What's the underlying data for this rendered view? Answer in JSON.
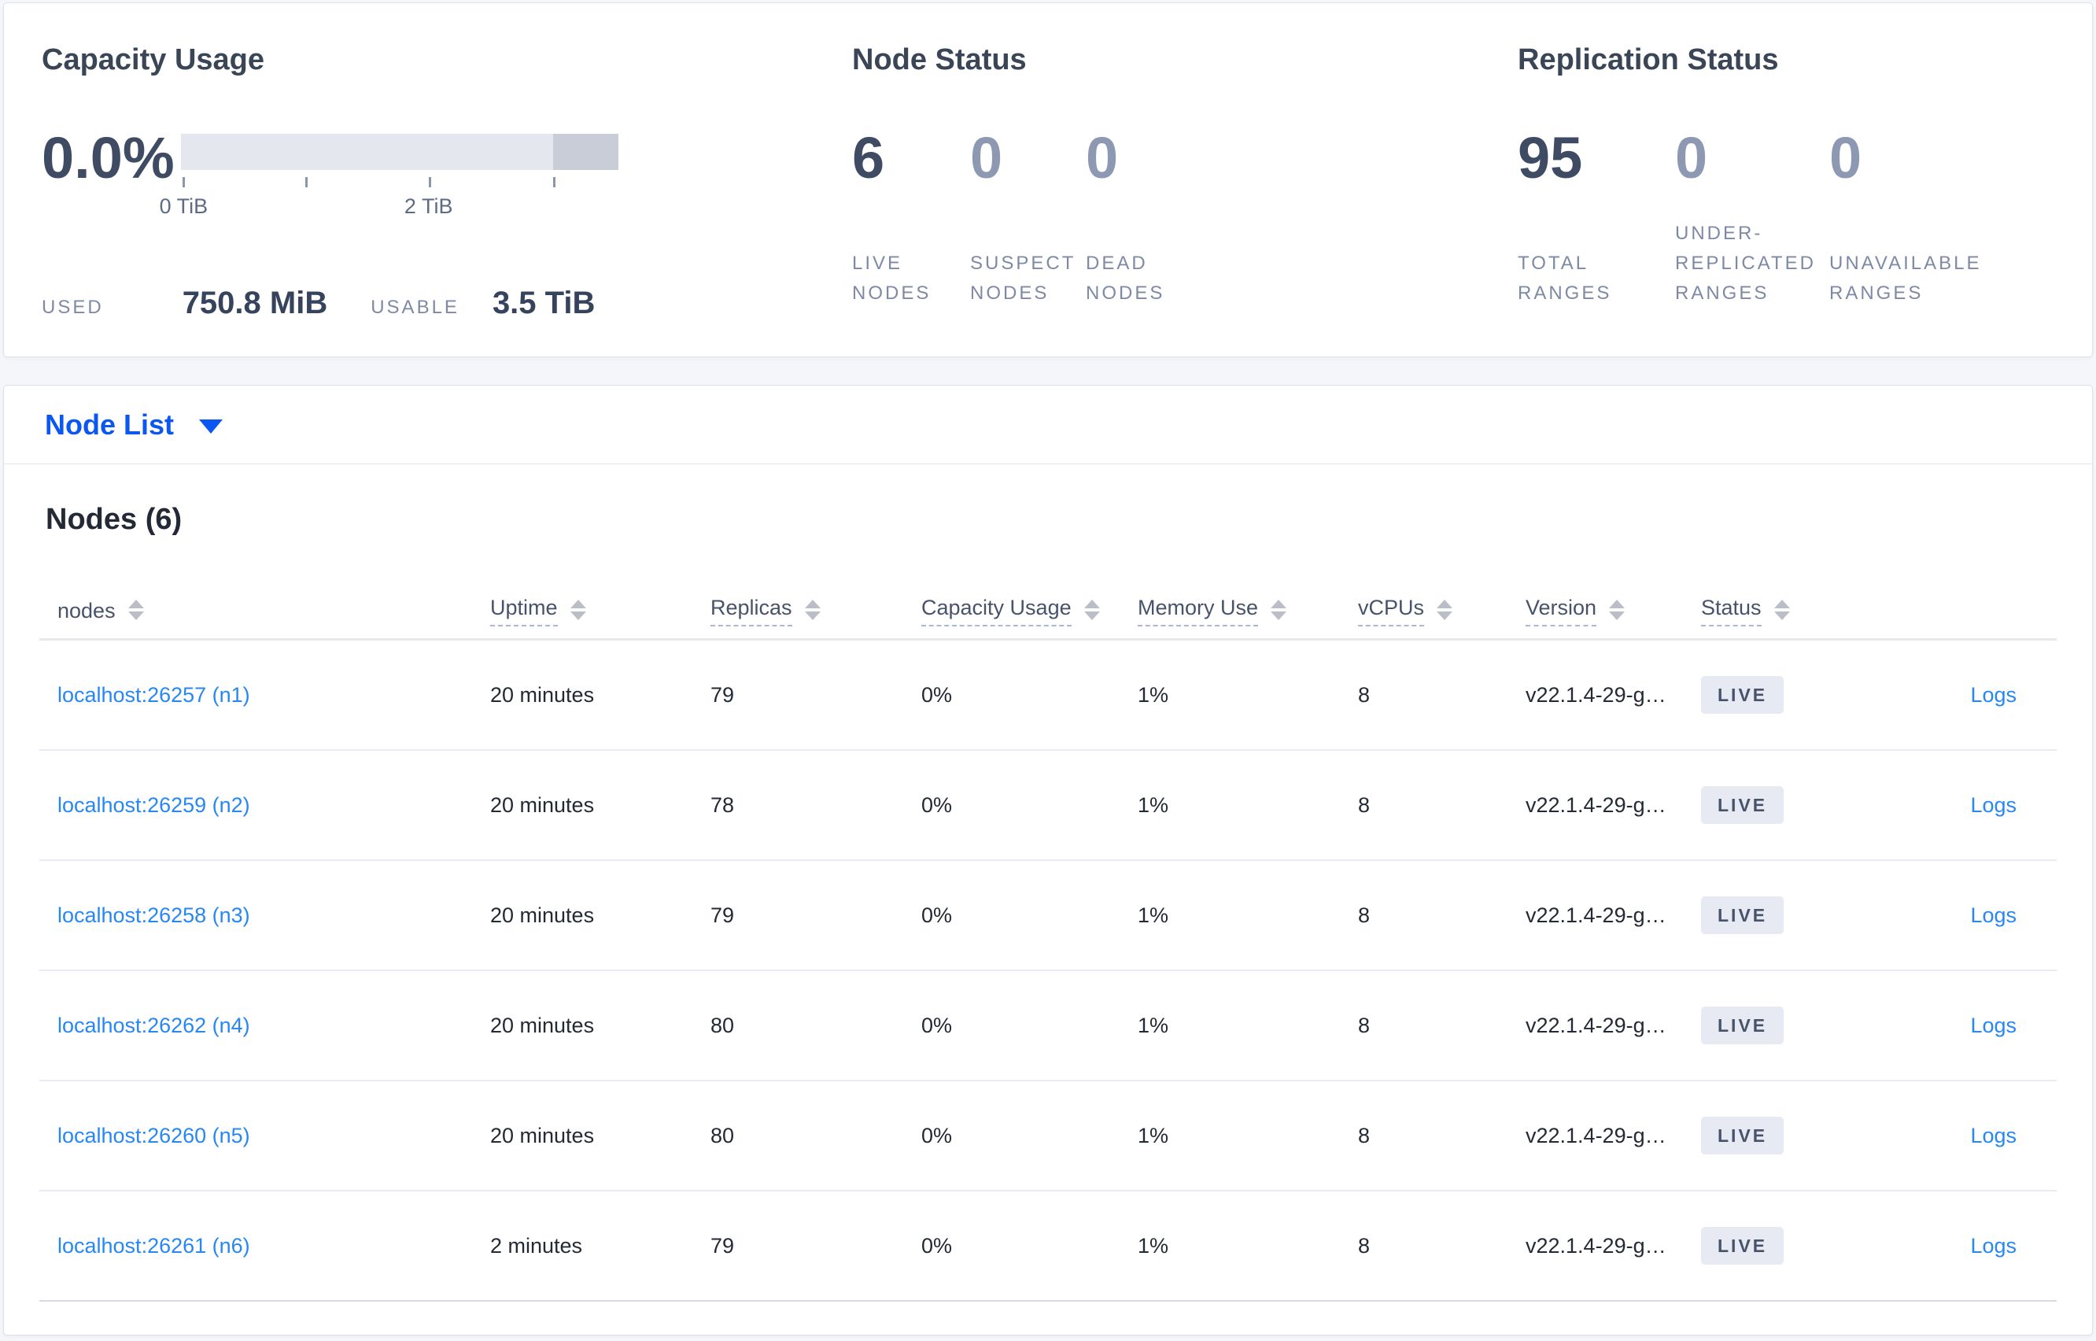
{
  "summary": {
    "capacity": {
      "title": "Capacity Usage",
      "percent": "0.0%",
      "axis_ticks": [
        "0 TiB",
        "2 TiB"
      ],
      "used_label": "USED",
      "used_value": "750.8 MiB",
      "usable_label": "USABLE",
      "usable_value": "3.5 TiB"
    },
    "node_status": {
      "title": "Node Status",
      "stats": [
        {
          "value": "6",
          "label": "LIVE NODES"
        },
        {
          "value": "0",
          "label": "SUSPECT NODES"
        },
        {
          "value": "0",
          "label": "DEAD NODES"
        }
      ]
    },
    "replication": {
      "title": "Replication Status",
      "stats": [
        {
          "value": "95",
          "label": "TOTAL RANGES"
        },
        {
          "value": "0",
          "label": "UNDER-REPLICATED RANGES"
        },
        {
          "value": "0",
          "label": "UNAVAILABLE RANGES"
        }
      ]
    }
  },
  "node_list": {
    "dropdown_label": "Node List",
    "dropdown_icon": "caret-down-icon",
    "heading": "Nodes (6)"
  },
  "table": {
    "columns": [
      {
        "label": "nodes",
        "sortable": true,
        "tooltip": false
      },
      {
        "label": "Uptime",
        "sortable": true,
        "tooltip": true
      },
      {
        "label": "Replicas",
        "sortable": true,
        "tooltip": true
      },
      {
        "label": "Capacity Usage",
        "sortable": true,
        "tooltip": true
      },
      {
        "label": "Memory Use",
        "sortable": true,
        "tooltip": true
      },
      {
        "label": "vCPUs",
        "sortable": true,
        "tooltip": true
      },
      {
        "label": "Version",
        "sortable": true,
        "tooltip": true
      },
      {
        "label": "Status",
        "sortable": true,
        "tooltip": true
      },
      {
        "label": "",
        "sortable": false,
        "tooltip": false
      }
    ],
    "rows": [
      {
        "address": "localhost:26257 (n1)",
        "uptime": "20 minutes",
        "replicas": "79",
        "capacity_usage": "0%",
        "memory_use": "1%",
        "vcpus": "8",
        "version": "v22.1.4-29-g…",
        "status": "LIVE",
        "logs": "Logs"
      },
      {
        "address": "localhost:26259 (n2)",
        "uptime": "20 minutes",
        "replicas": "78",
        "capacity_usage": "0%",
        "memory_use": "1%",
        "vcpus": "8",
        "version": "v22.1.4-29-g…",
        "status": "LIVE",
        "logs": "Logs"
      },
      {
        "address": "localhost:26258 (n3)",
        "uptime": "20 minutes",
        "replicas": "79",
        "capacity_usage": "0%",
        "memory_use": "1%",
        "vcpus": "8",
        "version": "v22.1.4-29-g…",
        "status": "LIVE",
        "logs": "Logs"
      },
      {
        "address": "localhost:26262 (n4)",
        "uptime": "20 minutes",
        "replicas": "80",
        "capacity_usage": "0%",
        "memory_use": "1%",
        "vcpus": "8",
        "version": "v22.1.4-29-g…",
        "status": "LIVE",
        "logs": "Logs"
      },
      {
        "address": "localhost:26260 (n5)",
        "uptime": "20 minutes",
        "replicas": "80",
        "capacity_usage": "0%",
        "memory_use": "1%",
        "vcpus": "8",
        "version": "v22.1.4-29-g…",
        "status": "LIVE",
        "logs": "Logs"
      },
      {
        "address": "localhost:26261 (n6)",
        "uptime": "2 minutes",
        "replicas": "79",
        "capacity_usage": "0%",
        "memory_use": "1%",
        "vcpus": "8",
        "version": "v22.1.4-29-g…",
        "status": "LIVE",
        "logs": "Logs"
      }
    ]
  },
  "colors": {
    "primary_link": "#0b57f2",
    "row_link": "#2787f3",
    "badge_bg": "#e7eaf2",
    "badge_text": "#47536b",
    "bar_fill": "#e4e7ee",
    "bar_fill_dark": "#c9cdd8",
    "stat_number": "#3e4b63",
    "stat_number_zero": "#8d99b2"
  }
}
